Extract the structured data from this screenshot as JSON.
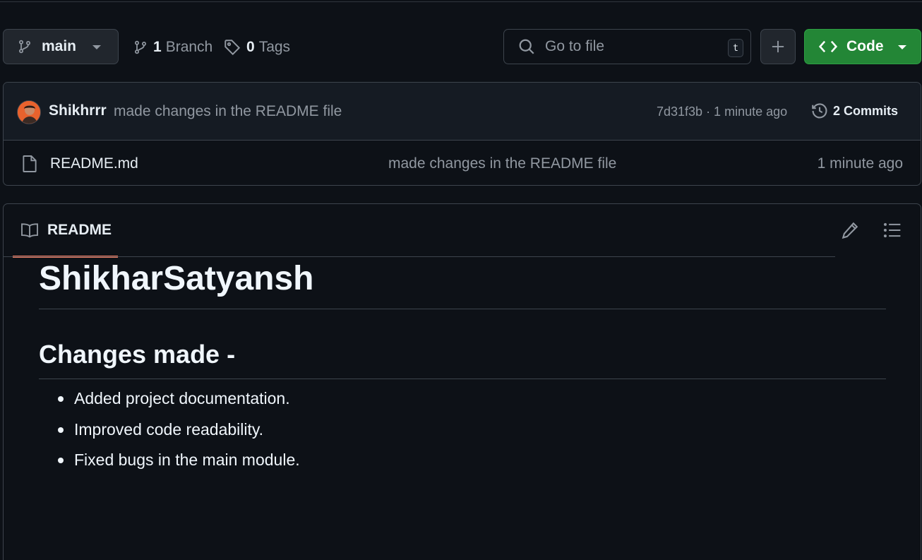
{
  "toolbar": {
    "branch": "main",
    "branches_count": "1",
    "branches_label": "Branch",
    "tags_count": "0",
    "tags_label": "Tags",
    "search_placeholder": "Go to file",
    "search_shortcut": "t",
    "code_label": "Code"
  },
  "commit": {
    "author": "Shikhrrr",
    "message": "made changes in the README file",
    "meta": "7d31f3b · 1 minute ago",
    "commits_label": "2 Commits"
  },
  "files": [
    {
      "name": "README.md",
      "message": "made changes in the README file",
      "time": "1 minute ago"
    }
  ],
  "readme": {
    "tab_label": "README",
    "h1": "ShikharSatyansh",
    "h2": "Changes made -",
    "items": [
      "Added project documentation.",
      "Improved code readability.",
      "Fixed bugs in the main module."
    ]
  },
  "colors": {
    "background": "#0d1117",
    "code_button": "#238636",
    "tab_underline": "#f78166"
  }
}
